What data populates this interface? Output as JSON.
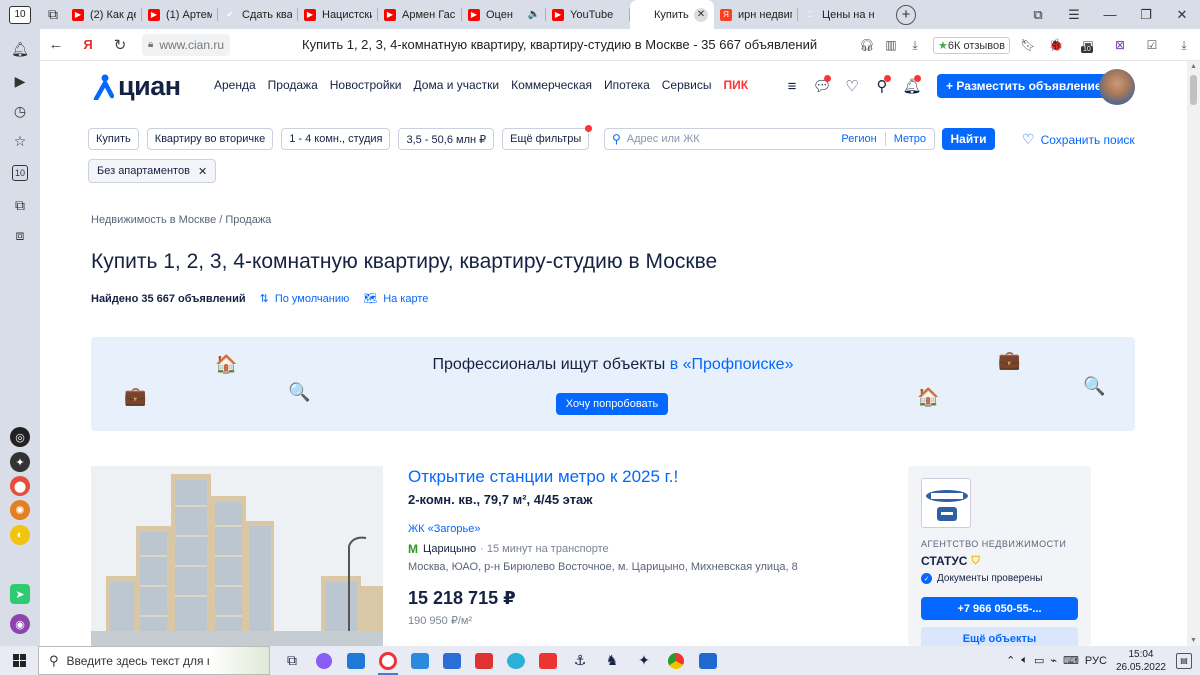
{
  "browser": {
    "tab_count": "10",
    "tabs": [
      {
        "title": "(2) Как дел",
        "icon": "youtube"
      },
      {
        "title": "(1) Артеми",
        "icon": "youtube"
      },
      {
        "title": "Сдать квар",
        "icon": "check"
      },
      {
        "title": "Нацистски",
        "icon": "youtube"
      },
      {
        "title": "Армен Гас",
        "icon": "youtube"
      },
      {
        "title": "Оцен",
        "icon": "youtube",
        "audio": true
      },
      {
        "title": "YouTube",
        "icon": "youtube"
      },
      {
        "title": "Купить",
        "icon": "cian",
        "active": true
      },
      {
        "title": "ирн недвиг",
        "icon": "yandex"
      },
      {
        "title": "Цены на н",
        "icon": "dots"
      }
    ],
    "url": "www.cian.ru",
    "page_title": "Купить 1, 2, 3, 4-комнатную квартиру, квартиру-студию в Москве - 35 667 объявлений",
    "reviews": "6К отзывов",
    "ext_badge": "10"
  },
  "header": {
    "logo": "циан",
    "nav": [
      "Аренда",
      "Продажа",
      "Новостройки",
      "Дома и участки",
      "Коммерческая",
      "Ипотека",
      "Сервисы"
    ],
    "nav_pik": "ПИК",
    "post_button": "+ Разместить объявление"
  },
  "filters": {
    "deal": "Купить",
    "type": "Квартиру во вторичке",
    "rooms": "1 - 4 комн., студия",
    "price": "3,5 - 50,6 млн ₽",
    "more": "Ещё фильтры",
    "address_placeholder": "Адрес или ЖК",
    "region": "Регион",
    "metro": "Метро",
    "find": "Найти",
    "save": "Сохранить поиск",
    "chip": "Без апартаментов"
  },
  "breadcrumbs": [
    "Недвижимость в Москве",
    "Продажа"
  ],
  "title": "Купить 1, 2, 3, 4-комнатную квартиру, квартиру-студию в Москве",
  "found": "Найдено 35 667 объявлений",
  "sort": "По умолчанию",
  "map": "На карте",
  "banner": {
    "text": "Профессионалы ищут объекты",
    "highlight": "в «Профпоиске»",
    "button": "Хочу попробовать"
  },
  "listing": {
    "title": "Открытие станции метро к 2025 г.!",
    "specs": "2-комн. кв., 79,7 м², 4/45 этаж",
    "complex": "ЖК «Загорье»",
    "metro_station": "Царицыно",
    "transit": "· 15 минут на транспорте",
    "address": "Москва, ЮАО, р-н Бирюлево Восточное, м. Царицыно, Михневская улица, 8",
    "price": "15 218 715 ₽",
    "price_per_m": "190 950 ₽/м²"
  },
  "agent": {
    "kind": "АГЕНТСТВО НЕДВИЖИМОСТИ",
    "name": "СТАТУС",
    "verified": "Документы проверены",
    "phone": "+7 966 050-55-...",
    "more": "Ещё объекты"
  },
  "taskbar": {
    "search_placeholder": "Введите здесь текст для поиска",
    "lang": "РУС",
    "time": "15:04",
    "date": "26.05.2022"
  },
  "colors": {
    "accent": "#0468ff",
    "pik": "#ff3333",
    "text": "#152242"
  }
}
